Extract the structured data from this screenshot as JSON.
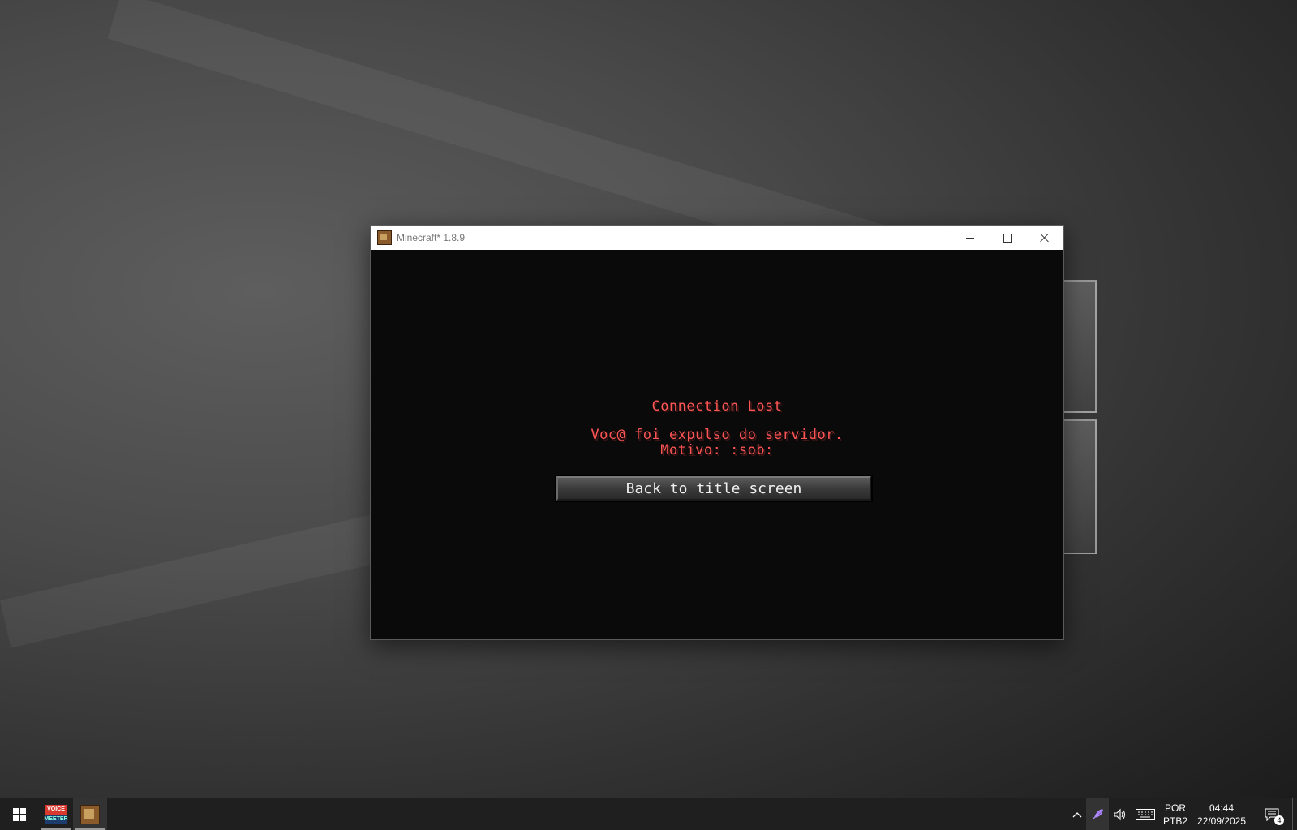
{
  "window": {
    "title": "Minecraft* 1.8.9",
    "controls": {
      "minimize": "minimize",
      "maximize": "maximize",
      "close": "close"
    }
  },
  "game": {
    "heading": "Connection Lost",
    "message_line1": "Voc@ foi expulso do servidor.",
    "message_line2": "Motivo: :sob:",
    "back_button": "Back to title screen",
    "text_color": "#ff5555"
  },
  "taskbar": {
    "apps": [
      {
        "name": "voicemeeter",
        "label_top": "VOICE",
        "label_bottom": "MEETER",
        "icon": "voicemeeter-icon"
      },
      {
        "name": "minecraft",
        "icon": "minecraft-icon"
      }
    ],
    "tray": {
      "show_hidden": "^",
      "speaker_glyph": "🕪",
      "language_line1": "POR",
      "language_line2": "PTB2",
      "time": "04:44",
      "date": "22/09/2025",
      "notification_count": "4"
    }
  }
}
